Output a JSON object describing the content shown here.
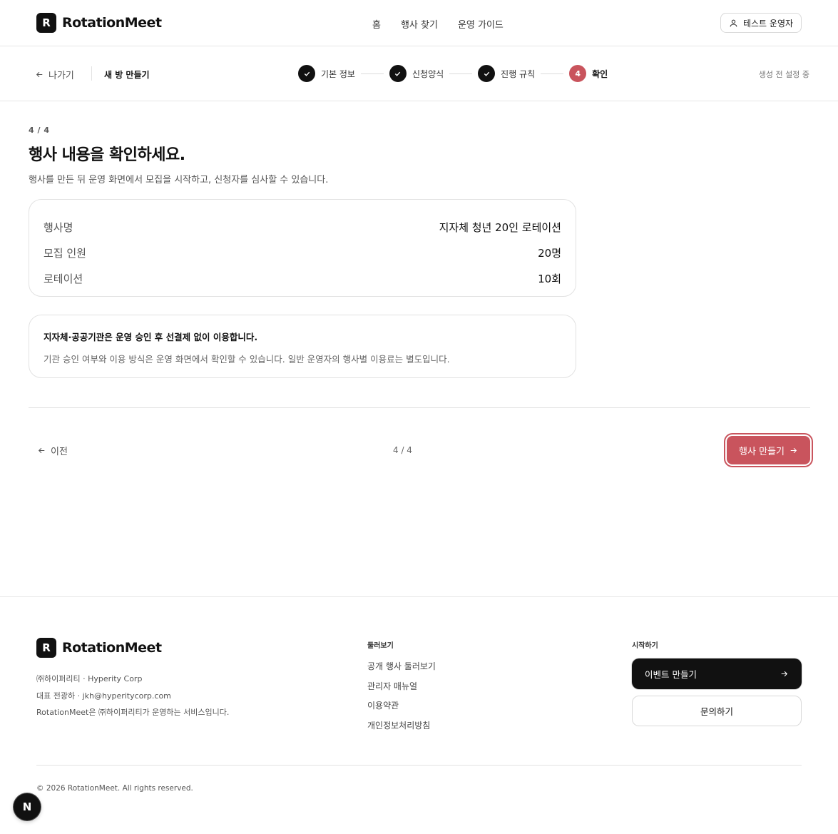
{
  "header": {
    "logo_mark": "R",
    "logo_text": "RotationMeet",
    "nav": [
      "홈",
      "행사 찾기",
      "운영 가이드"
    ],
    "user_label": "테스트 운영자"
  },
  "stepbar": {
    "exit_label": "나가기",
    "page_heading": "새 방 만들기",
    "steps": [
      {
        "label": "기본 정보",
        "state": "done"
      },
      {
        "label": "신청양식",
        "state": "done"
      },
      {
        "label": "진행 규칙",
        "state": "done"
      },
      {
        "label": "확인",
        "state": "active",
        "number": "4"
      }
    ],
    "status": "생성 전 설정 중"
  },
  "main": {
    "step_count": "4 / 4",
    "title": "행사 내용을 확인하세요.",
    "subtitle": "행사를 만든 뒤 운영 화면에서 모집을 시작하고, 신청자를 심사할 수 있습니다.",
    "summary": [
      {
        "label": "행사명",
        "value": "지자체 청년 20인 로테이션"
      },
      {
        "label": "모집 인원",
        "value": "20명"
      },
      {
        "label": "로테이션",
        "value": "10회"
      }
    ],
    "notice_title": "지자체·공공기관은 운영 승인 후 선결제 없이 이용합니다.",
    "notice_body": "기관 승인 여부와 이용 방식은 운영 화면에서 확인할 수 있습니다. 일반 운영자의 행사별 이용료는 별도입니다."
  },
  "actions": {
    "prev_label": "이전",
    "page_indicator": "4 / 4",
    "create_label": "행사 만들기"
  },
  "footer": {
    "logo_mark": "R",
    "logo_text": "RotationMeet",
    "company": "㈜하이퍼리티 · Hyperity Corp",
    "ceo": "대표 전광하 · jkh@hyperitycorp.com",
    "desc": "RotationMeet은 ㈜하이퍼리티가 운영하는 서비스입니다.",
    "browse_title": "둘러보기",
    "browse_links": [
      "공개 행사 둘러보기",
      "관리자 매뉴얼",
      "이용약관",
      "개인정보처리방침"
    ],
    "start_title": "시작하기",
    "cta_primary": "이벤트 만들기",
    "cta_secondary": "문의하기",
    "copyright": "© 2026 RotationMeet. All rights reserved."
  },
  "badge": "N",
  "colors": {
    "accent": "#c9545d",
    "dark": "#111111"
  }
}
